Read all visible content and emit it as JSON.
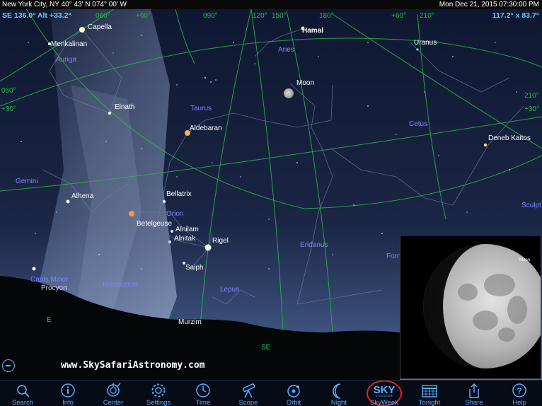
{
  "status_bar": {
    "location": "New York City, NY   40° 43' N 074° 00' W",
    "datetime": "Mon Dec 21, 2015   07:30:00 PM"
  },
  "view": {
    "direction": "SE 136.0° Alt +33.2°",
    "field_of_view": "117.2° x 83.7°"
  },
  "coordinate_labels": [
    "060°",
    "+60°",
    "090°",
    "120°",
    "150°",
    "180°",
    "+60°",
    "210°",
    "060°",
    "+30°",
    "210°",
    "+30°"
  ],
  "stars": [
    "Capella",
    "Menkalinan",
    "Elnath",
    "Aldebaran",
    "Alhena",
    "Bellatrix",
    "Betelgeuse",
    "Alnilam",
    "Alnitak",
    "Rigel",
    "Saiph",
    "Murzim",
    "Hamal",
    "Uranus",
    "Deneb Kaitos",
    "Moon",
    "Canis Minor",
    "Procyon"
  ],
  "constellations": [
    "Auriga",
    "Taurus",
    "Aries",
    "Cetus",
    "Gemini",
    "Orion",
    "Eridanus",
    "Monoceros",
    "Lepus",
    "Sculpt",
    "Forn"
  ],
  "horizon_markers": [
    "E",
    "SE"
  ],
  "website": "www.SkySafariAstronomy.com",
  "inset": {
    "label": "Moon",
    "phase_illuminated": 0.78
  },
  "toolbar": [
    {
      "label": "Search",
      "icon": "search-icon"
    },
    {
      "label": "Info",
      "icon": "info-icon"
    },
    {
      "label": "Center",
      "icon": "center-icon"
    },
    {
      "label": "Settings",
      "icon": "settings-icon"
    },
    {
      "label": "Time",
      "icon": "clock-icon"
    },
    {
      "label": "Scope",
      "icon": "telescope-icon"
    },
    {
      "label": "Orbit",
      "icon": "orbit-icon"
    },
    {
      "label": "Night",
      "icon": "moon-icon"
    },
    {
      "label": "SkyWeek",
      "icon": "sky-logo-icon",
      "logo_text": "SKY",
      "logo_subtext": "& TELESCOPE"
    },
    {
      "label": "Tonight",
      "icon": "calendar-icon"
    },
    {
      "label": "Share",
      "icon": "share-icon"
    },
    {
      "label": "Help",
      "icon": "help-icon"
    }
  ],
  "colors": {
    "label_blue": "#5ab0ff",
    "constellation_name": "#7f85ff",
    "grid_green": "#2bb84a",
    "readout_cyan": "#5ad0ff",
    "skyweek_ring": "#e02020"
  }
}
